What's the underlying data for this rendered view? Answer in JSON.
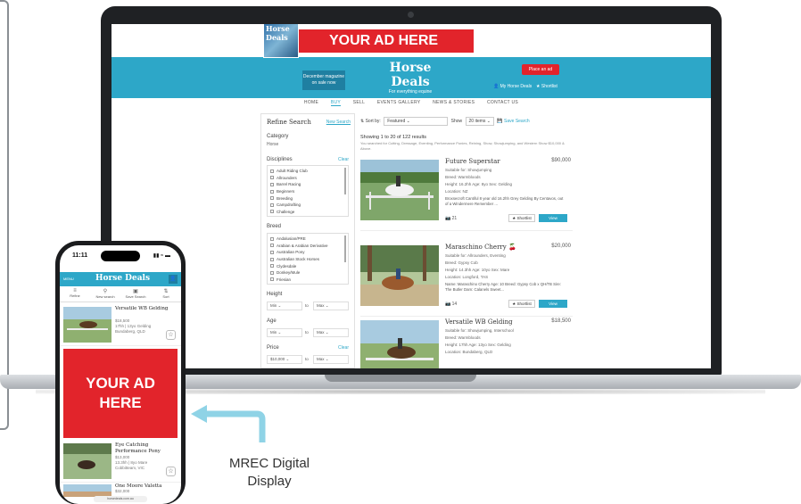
{
  "website": {
    "top_ad": "YOUR AD HERE",
    "magazine_title": "Horse Deals",
    "magazine_banner": "December magazine on sale now",
    "logo": "Horse Deals",
    "tagline": "For everything equine",
    "place_ad": "Place an ad",
    "my_horse_deals": "My Horse Deals",
    "shortlist": "Shortlist",
    "nav": [
      "HOME",
      "BUY",
      "SELL",
      "EVENTS GALLERY",
      "NEWS & STORIES",
      "CONTACT US"
    ],
    "sidebar": {
      "title": "Refine Search",
      "new_search": "New Search",
      "category_label": "Category",
      "category_value": "Horse",
      "disciplines_label": "Disciplines",
      "clear": "Clear",
      "disciplines": [
        "Adult Riding Club",
        "Allrounders",
        "Barrel Racing",
        "Beginners",
        "Breeding",
        "Campdrafting",
        "Challenge"
      ],
      "breed_label": "Breed",
      "breeds": [
        "Andalusian/PRE",
        "Arabian & Arabian Derivative",
        "Australian Pony",
        "Australian Stock Horses",
        "Clydesdale",
        "Donkey/Mule",
        "Friesian"
      ],
      "height_label": "Height",
      "age_label": "Age",
      "price_label": "Price",
      "min": "Min",
      "max": "Max",
      "to": "to",
      "price_min": "$10,000"
    },
    "sort_label": "Sort by:",
    "sort_value": "Featured",
    "show_label": "Show",
    "show_value": "20 items",
    "save_search": "Save Search",
    "showing": "Showing 1 to 20 of 122 results",
    "searched_for": "You searched for Cutting, Dressage, Eventing, Performance Ponies, Reining, Show, Showjumping, and Western Show $10,000 & Above.",
    "listings": [
      {
        "title": "Future Superstar",
        "price": "$90,000",
        "suitable": "Suitable for: Showjumping",
        "breed": "Breed: Warmbloods",
        "stats": "Height: 16.2hh   Age: 8yo   Sex: Gelding",
        "location": "Location: NZ",
        "desc": "Broxsecroft Cantiful 8 year old 16.2hh Grey Gelding By Centavos, out of a Windermere Remember ...",
        "photos": "21",
        "shortlist": "Shortlist",
        "view": "View"
      },
      {
        "title": "Maraschino Cherry",
        "price": "$20,000",
        "suitable": "Suitable for: Allrounders, Eventing",
        "breed": "Breed: Gypsy Cob",
        "stats": "Height: 14.3hh   Age: 10yo   Sex: Mare",
        "location": "Location: Longford, TAS",
        "desc": "Name: Maraschino Cherry Age: 10 Breed: Gypsy Cob x QH/TB Sire: The Butler Dam: Calanels Sweet...",
        "photos": "14",
        "shortlist": "Shortlist",
        "view": "View"
      },
      {
        "title": "Versatile WB Gelding",
        "price": "$18,500",
        "suitable": "Suitable for: Showjumping, Interschool",
        "breed": "Breed: Warmbloods",
        "stats": "Height: 17hh   Age: 13yo   Sex: Gelding",
        "location": "Location: Bundaberg, QLD"
      }
    ]
  },
  "phone": {
    "time": "11:11",
    "menu": "MENU",
    "logo": "Horse Deals",
    "tools": [
      "Refine",
      "New search",
      "Save Search",
      "Sort"
    ],
    "listings": [
      {
        "title": "Versatile WB Gelding",
        "price": "$18,500",
        "meta": "17hh | 13yo Gelding",
        "location": "Bundaberg, QLD"
      },
      {
        "title": "Eye Catching Performance Pony",
        "price": "$13,000",
        "meta": "13.3hh | 8yo Mare",
        "location": "Cobbitteam, VIC"
      },
      {
        "title": "One Moore Valetta",
        "price": "$32,000",
        "meta": "14.2hh | 7yo Mare",
        "location": ""
      }
    ],
    "ad": "YOUR AD HERE",
    "url": "horsedeals.com.au"
  },
  "caption": "MREC Digital Display",
  "colors": {
    "accent": "#2da7c8",
    "ad_red": "#e2242b",
    "arrow": "#8fd3e6"
  }
}
